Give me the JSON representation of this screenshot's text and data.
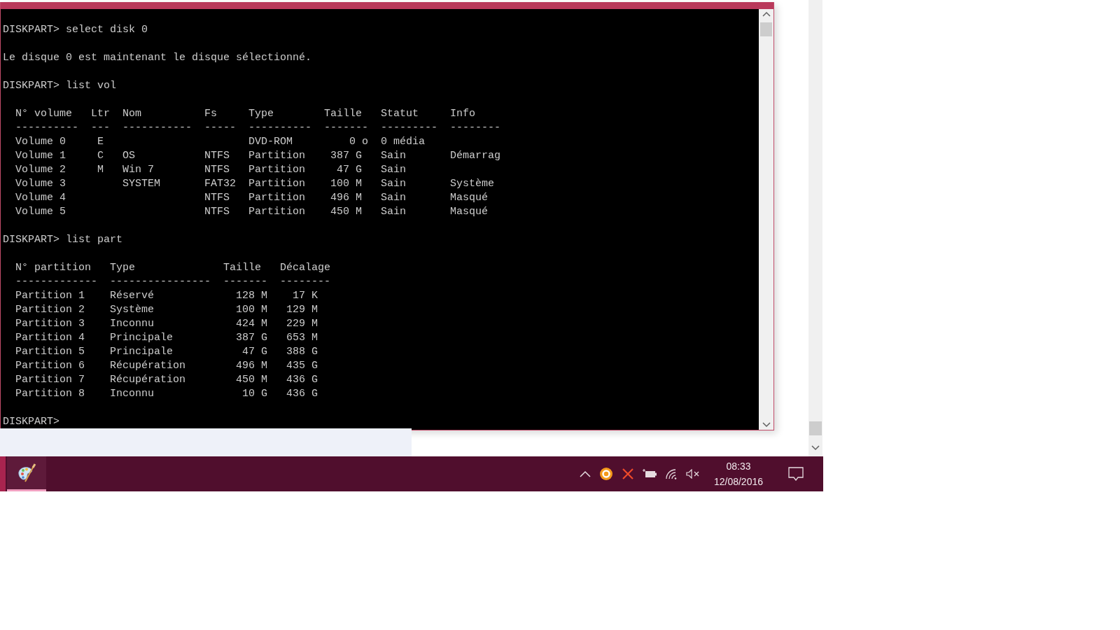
{
  "console": {
    "groups": [
      [
        "DISKPART> select disk 0"
      ],
      [
        "Le disque 0 est maintenant le disque sélectionné."
      ],
      [
        "DISKPART> list vol"
      ],
      [
        "  N° volume   Ltr  Nom          Fs     Type        Taille   Statut     Info",
        "  ----------  ---  -----------  -----  ----------  -------  ---------  --------",
        "  Volume 0     E                       DVD-ROM         0 o  0 média",
        "  Volume 1     C   OS           NTFS   Partition    387 G   Sain       Démarrag",
        "  Volume 2     M   Win 7        NTFS   Partition     47 G   Sain",
        "  Volume 3         SYSTEM       FAT32  Partition    100 M   Sain       Système",
        "  Volume 4                      NTFS   Partition    496 M   Sain       Masqué",
        "  Volume 5                      NTFS   Partition    450 M   Sain       Masqué"
      ],
      [
        "DISKPART> list part"
      ],
      [
        "  N° partition   Type              Taille   Décalage",
        "  -------------  ----------------  -------  --------",
        "  Partition 1    Réservé             128 M    17 K",
        "  Partition 2    Système             100 M   129 M",
        "  Partition 3    Inconnu             424 M   229 M",
        "  Partition 4    Principale          387 G   653 M",
        "  Partition 5    Principale           47 G   388 G",
        "  Partition 6    Récupération        496 M   435 G",
        "  Partition 7    Récupération        450 M   436 G",
        "  Partition 8    Inconnu              10 G   436 G"
      ],
      [
        "DISKPART>"
      ]
    ]
  },
  "taskbar": {
    "apps": [
      {
        "selected": true
      }
    ],
    "clock": {
      "time": "08:33",
      "date": "12/08/2016"
    }
  }
}
